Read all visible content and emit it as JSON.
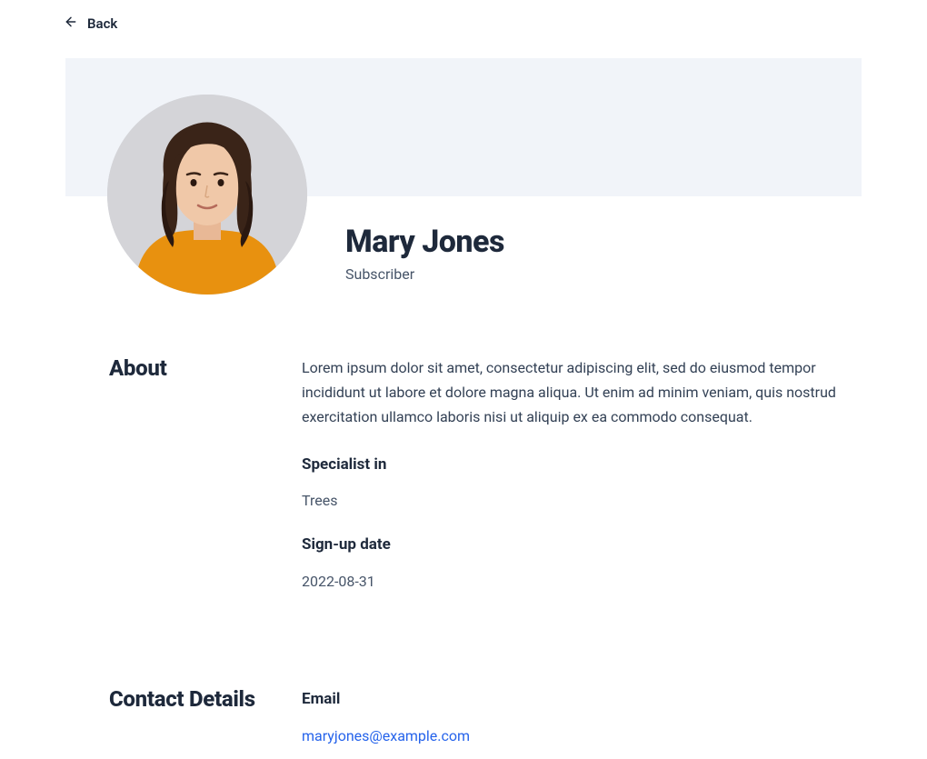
{
  "nav": {
    "back_label": "Back"
  },
  "profile": {
    "name": "Mary Jones",
    "role": "Subscriber"
  },
  "about": {
    "heading": "About",
    "bio": "Lorem ipsum dolor sit amet, consectetur adipiscing elit, sed do eiusmod tempor incididunt ut labore et dolore magna aliqua. Ut enim ad minim veniam, quis nostrud exercitation ullamco laboris nisi ut aliquip ex ea commodo consequat.",
    "specialist_label": "Specialist in",
    "specialist_value": "Trees",
    "signup_label": "Sign-up date",
    "signup_value": "2022-08-31"
  },
  "contact": {
    "heading": "Contact Details",
    "email_label": "Email",
    "email_value": "maryjones@example.com"
  }
}
